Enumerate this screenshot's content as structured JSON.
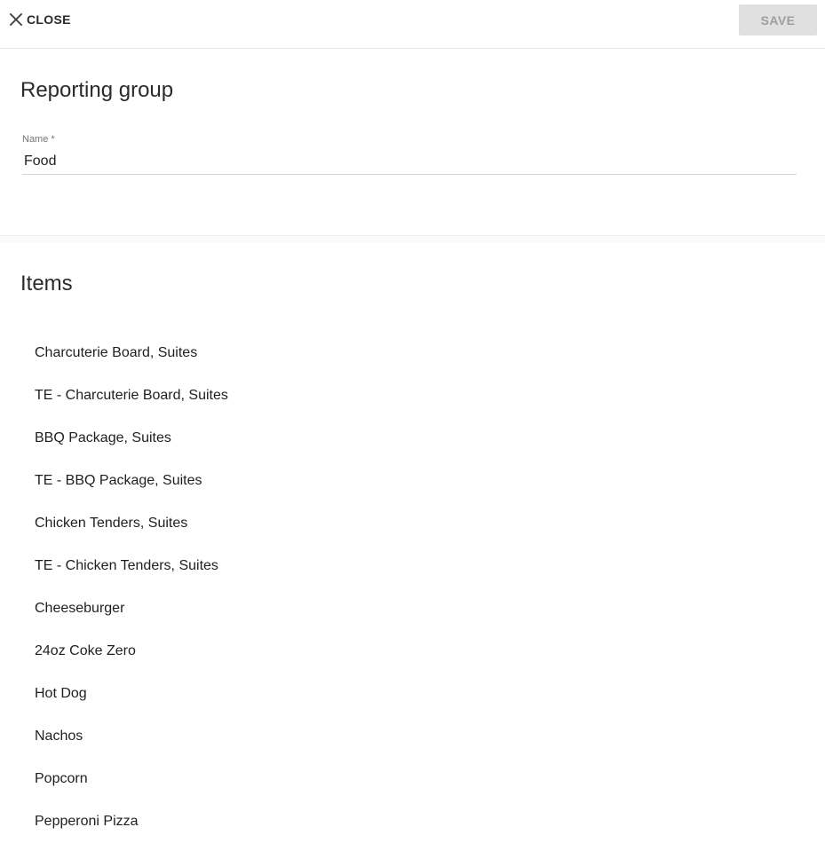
{
  "toolbar": {
    "close_label": "CLOSE",
    "close_icon": "close-icon",
    "save_label": "SAVE"
  },
  "group": {
    "title": "Reporting group",
    "name_field": {
      "label": "Name *",
      "value": "Food"
    }
  },
  "items": {
    "title": "Items",
    "list": [
      "Charcuterie Board, Suites",
      "TE - Charcuterie Board, Suites",
      "BBQ Package, Suites",
      "TE - BBQ Package, Suites",
      "Chicken Tenders, Suites",
      "TE - Chicken Tenders, Suites",
      "Cheeseburger",
      "24oz Coke Zero",
      "Hot Dog",
      "Nachos",
      "Popcorn",
      "Pepperoni Pizza"
    ]
  },
  "colors": {
    "save_bg": "#e0e0e0",
    "save_text": "#9e9e9e",
    "text": "#212121"
  }
}
